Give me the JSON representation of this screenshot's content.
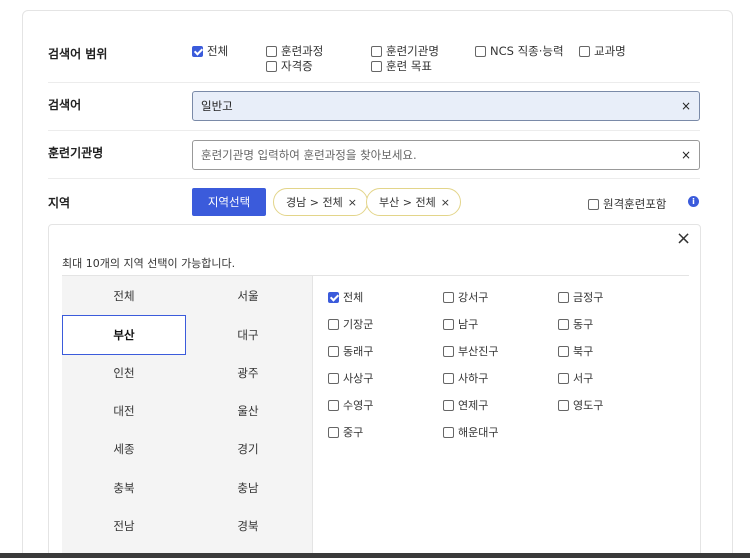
{
  "scope": {
    "label": "검색어 범위",
    "options": [
      {
        "label": "전체",
        "checked": true
      },
      {
        "label": "훈련과정",
        "checked": false
      },
      {
        "label": "훈련기관명",
        "checked": false
      },
      {
        "label": "NCS 직종·능력",
        "checked": false
      },
      {
        "label": "교과명",
        "checked": false
      },
      {
        "label": "자격증",
        "checked": false
      },
      {
        "label": "훈련 목표",
        "checked": false
      }
    ]
  },
  "keyword": {
    "label": "검색어",
    "value": "일반고",
    "clear": "×"
  },
  "institution": {
    "label": "훈련기관명",
    "placeholder": "훈련기관명 입력하여 훈련과정을 찾아보세요.",
    "clear": "×"
  },
  "region": {
    "label": "지역",
    "select_button": "지역선택",
    "chips": [
      {
        "label": "경남 > 전체",
        "remove": "×"
      },
      {
        "label": "부산 > 전체",
        "remove": "×"
      }
    ],
    "remote_option": {
      "label": "원격훈련포함",
      "checked": false
    },
    "info_icon": "i"
  },
  "panel": {
    "close": "×",
    "note": "최대 10개의 지역 선택이 가능합니다.",
    "regions": [
      "전체",
      "서울",
      "부산",
      "대구",
      "인천",
      "광주",
      "대전",
      "울산",
      "세종",
      "경기",
      "충북",
      "충남",
      "전남",
      "경북"
    ],
    "selected_region": "부산",
    "districts": [
      {
        "label": "전체",
        "checked": true
      },
      {
        "label": "강서구",
        "checked": false
      },
      {
        "label": "금정구",
        "checked": false
      },
      {
        "label": "기장군",
        "checked": false
      },
      {
        "label": "남구",
        "checked": false
      },
      {
        "label": "동구",
        "checked": false
      },
      {
        "label": "동래구",
        "checked": false
      },
      {
        "label": "부산진구",
        "checked": false
      },
      {
        "label": "북구",
        "checked": false
      },
      {
        "label": "사상구",
        "checked": false
      },
      {
        "label": "사하구",
        "checked": false
      },
      {
        "label": "서구",
        "checked": false
      },
      {
        "label": "수영구",
        "checked": false
      },
      {
        "label": "연제구",
        "checked": false
      },
      {
        "label": "영도구",
        "checked": false
      },
      {
        "label": "중구",
        "checked": false
      },
      {
        "label": "해운대구",
        "checked": false
      }
    ]
  },
  "colors": {
    "accent": "#3b5bdb",
    "chip_border": "#e3d58a",
    "active_input": "#e8eef9"
  }
}
